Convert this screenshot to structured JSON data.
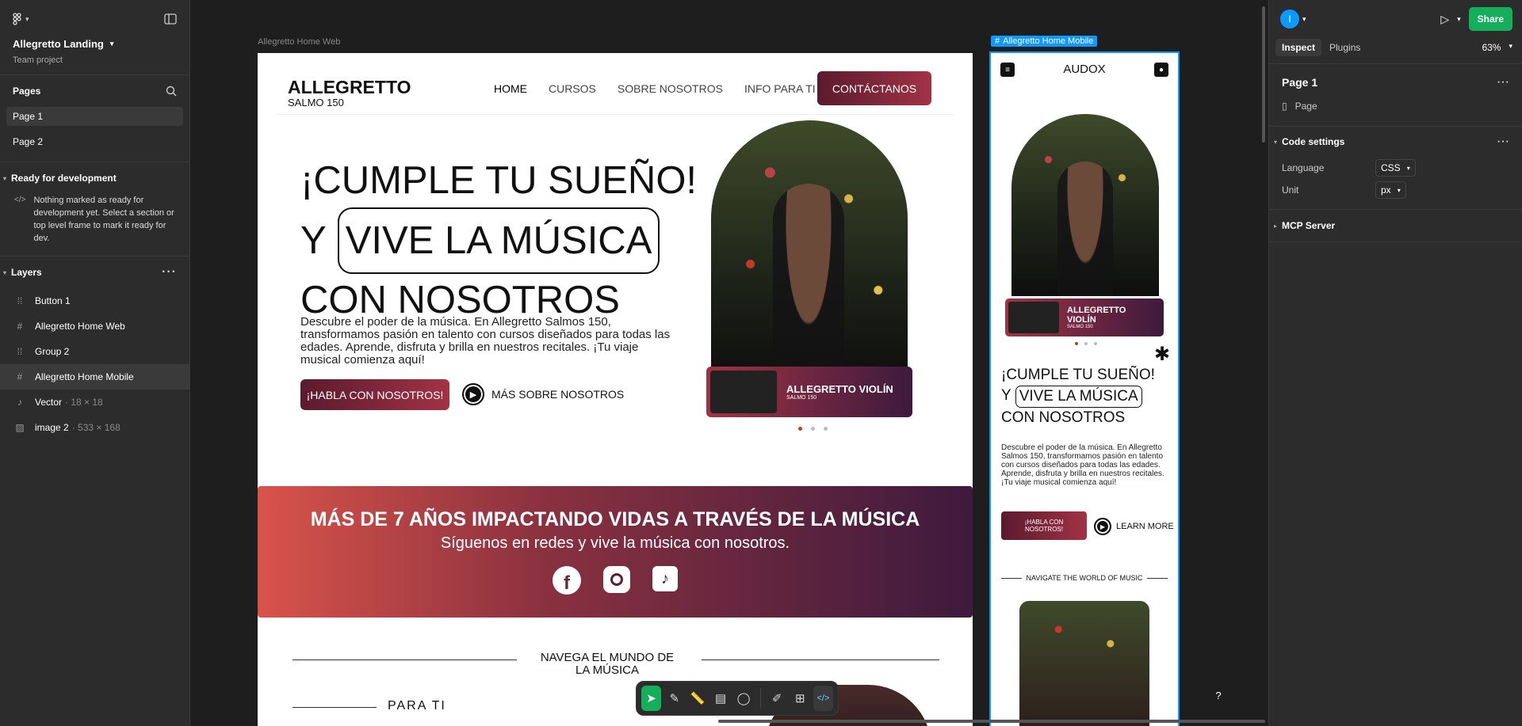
{
  "app": {
    "project_name": "Allegretto Landing",
    "team": "Team project"
  },
  "pages": {
    "title": "Pages",
    "items": [
      "Page 1",
      "Page 2"
    ]
  },
  "ready": {
    "title": "Ready for development",
    "message": "Nothing marked as ready for development yet. Select a section or top level frame to mark it ready for dev."
  },
  "layers": {
    "title": "Layers",
    "items": [
      {
        "name": "Button 1",
        "icon": "group-icon",
        "meta": ""
      },
      {
        "name": "Allegretto Home Web",
        "icon": "frame-icon",
        "meta": ""
      },
      {
        "name": "Group 2",
        "icon": "group-icon",
        "meta": ""
      },
      {
        "name": "Allegretto Home Mobile",
        "icon": "frame-icon",
        "meta": ""
      },
      {
        "name": "Vector",
        "icon": "tiktok-icon",
        "meta": "· 18 × 18"
      },
      {
        "name": "image 2",
        "icon": "image-icon",
        "meta": "· 533 × 168"
      }
    ]
  },
  "canvas": {
    "web_label": "Allegretto Home Web",
    "mobile_label": "Allegretto Home Mobile",
    "web": {
      "logo_main": "ALLEGRETTO",
      "logo_sub": "SALMO 150",
      "nav": [
        "HOME",
        "CURSOS",
        "SOBRE NOSOTROS",
        "INFO PARA TI"
      ],
      "cta": "CONTÁCTANOS",
      "hero_line1": "¡CUMPLE TU SUEÑO!",
      "hero_y": "Y",
      "hero_boxed": "VIVE LA MÚSICA",
      "hero_line3": "CON NOSOTROS",
      "hero_desc": "Descubre el poder de la música. En Allegretto Salmos 150, transformamos pasión en talento con cursos diseñados para todas las edades. Aprende, disfruta y brilla en nuestros recitales. ¡Tu viaje musical comienza aquí!",
      "btn_talk": "¡HABLA CON NOSOTROS!",
      "btn_more": "MÁS SOBRE NOSOTROS",
      "card_title": "ALLEGRETTO VIOLÍN",
      "card_sub": "SALMO 150",
      "banner_title": "MÁS DE 7 AÑOS IMPACTANDO VIDAS A TRAVÉS DE LA MÚSICA",
      "banner_sub": "Síguenos en redes y vive la música con nosotros.",
      "navega": "NAVEGA EL MUNDO DE LA MÚSICA",
      "para_ti": "PARA TI"
    },
    "mobile": {
      "brand": "AUDOX",
      "card_title": "ALLEGRETTO VIOLÍN",
      "card_sub": "SALMO 150",
      "hero_line1": "¡CUMPLE TU SUEÑO!",
      "hero_y": "Y",
      "hero_boxed": "VIVE LA MÚSICA",
      "hero_line3": "CON NOSOTROS",
      "desc": "Descubre el poder de la música. En Allegretto Salmos 150, transformamos pasión en talento con cursos diseñados para todas las edades. Aprende, disfruta y brilla en nuestros recitales. ¡Tu viaje musical comienza aquí!",
      "btn_talk": "¡HABLA CON NOSOTROS!",
      "btn_more": "LEARN MORE",
      "navigate": "NAVIGATE THE WORLD OF MUSIC"
    }
  },
  "right": {
    "avatar": "I",
    "share": "Share",
    "tabs": [
      "Inspect",
      "Plugins"
    ],
    "zoom": "63%",
    "page_title": "Page 1",
    "page_type": "Page",
    "code_settings": "Code settings",
    "language_label": "Language",
    "language_value": "CSS",
    "unit_label": "Unit",
    "unit_value": "px",
    "mcp": "MCP Server"
  },
  "colors": {
    "accent": "#0d99ff",
    "share": "#14ae5c",
    "brand_red": "#a23245",
    "brand_purple": "#3d1a3d"
  }
}
